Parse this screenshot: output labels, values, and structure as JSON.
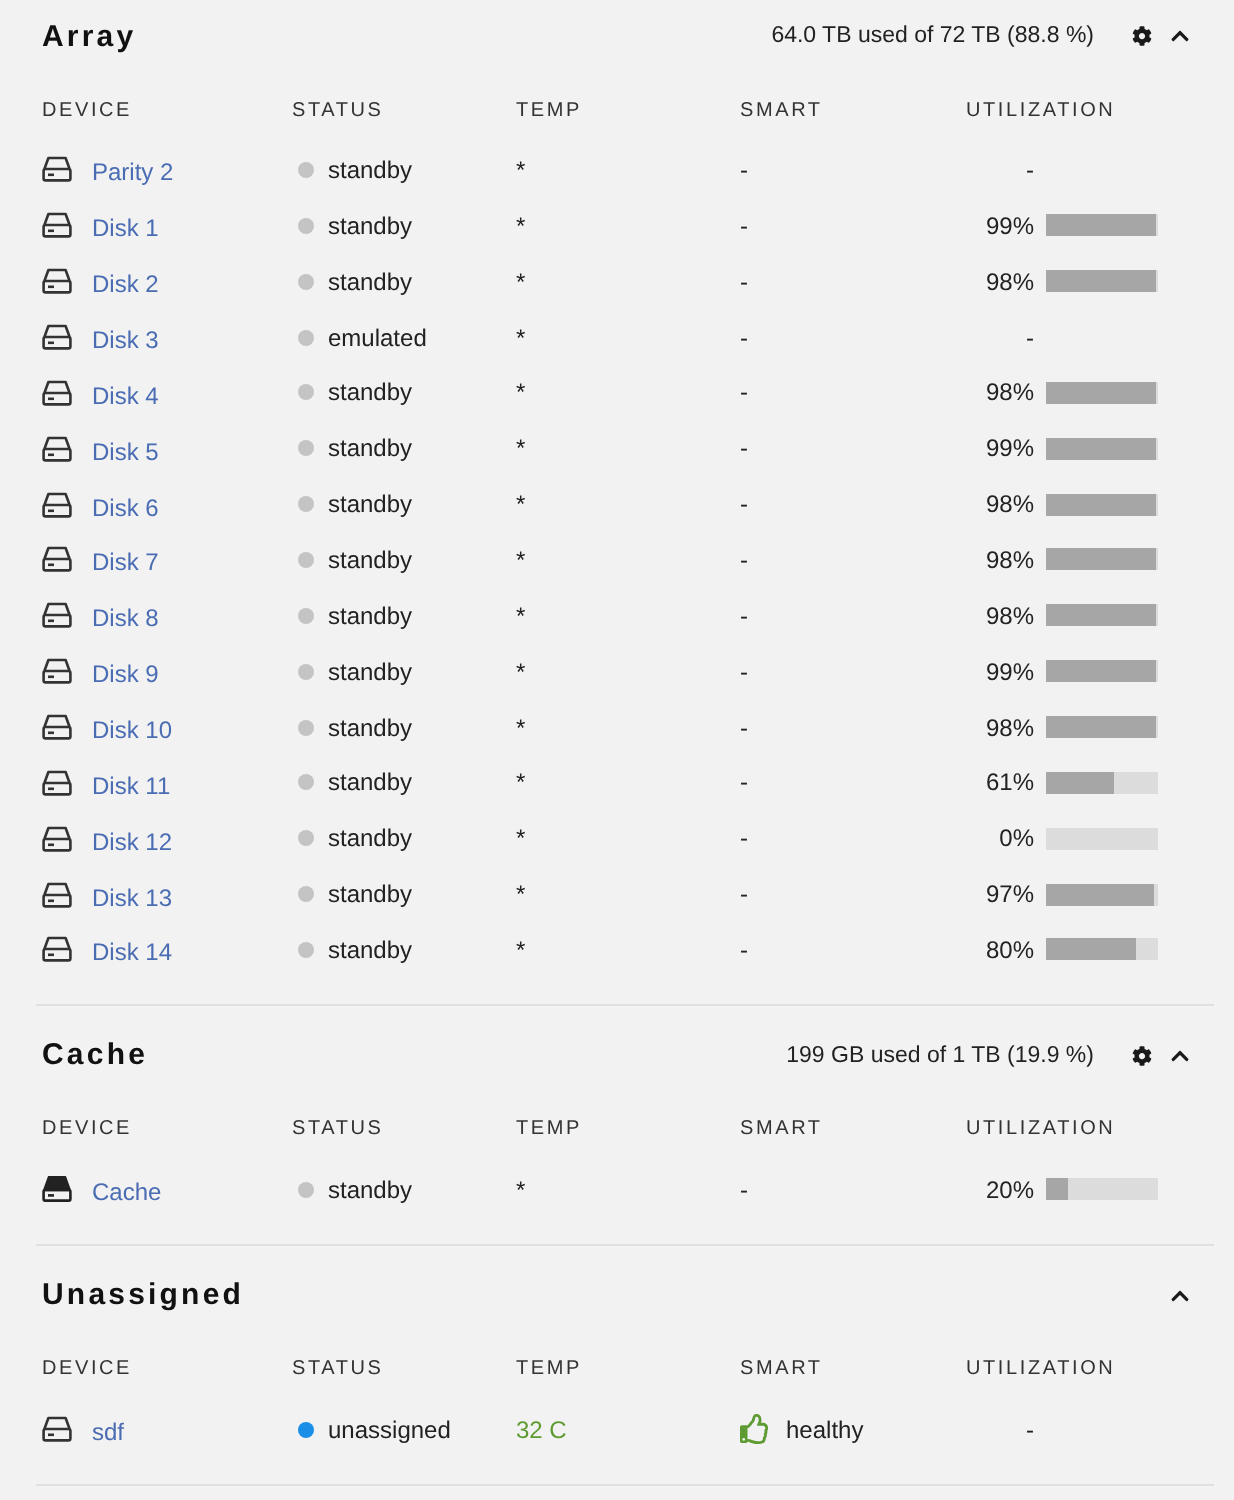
{
  "sections": [
    {
      "title": "Array",
      "summary": "64.0 TB used of 72 TB (88.8 %)",
      "settings": true,
      "expanded": true,
      "columns": [
        "DEVICE",
        "STATUS",
        "TEMP",
        "SMART",
        "UTILIZATION"
      ],
      "rows": [
        {
          "kind": "hdd",
          "name": "Parity 2",
          "status": {
            "text": "standby",
            "color": "#c4c4c4"
          },
          "temp": {
            "text": "*"
          },
          "smart": {
            "text": "-"
          },
          "utilization": {
            "text": "-"
          }
        },
        {
          "kind": "hdd",
          "name": "Disk 1",
          "status": {
            "text": "standby",
            "color": "#c4c4c4"
          },
          "temp": {
            "text": "*"
          },
          "smart": {
            "text": "-"
          },
          "utilization": {
            "text": "99%",
            "level": 0.99
          }
        },
        {
          "kind": "hdd",
          "name": "Disk 2",
          "status": {
            "text": "standby",
            "color": "#c4c4c4"
          },
          "temp": {
            "text": "*"
          },
          "smart": {
            "text": "-"
          },
          "utilization": {
            "text": "98%",
            "level": 0.98
          }
        },
        {
          "kind": "hdd",
          "name": "Disk 3",
          "status": {
            "text": "emulated",
            "color": "#c4c4c4"
          },
          "temp": {
            "text": "*"
          },
          "smart": {
            "text": "-"
          },
          "utilization": {
            "text": "-"
          }
        },
        {
          "kind": "hdd",
          "name": "Disk 4",
          "status": {
            "text": "standby",
            "color": "#c4c4c4"
          },
          "temp": {
            "text": "*"
          },
          "smart": {
            "text": "-"
          },
          "utilization": {
            "text": "98%",
            "level": 0.98
          }
        },
        {
          "kind": "hdd",
          "name": "Disk 5",
          "status": {
            "text": "standby",
            "color": "#c4c4c4"
          },
          "temp": {
            "text": "*"
          },
          "smart": {
            "text": "-"
          },
          "utilization": {
            "text": "99%",
            "level": 0.99
          }
        },
        {
          "kind": "hdd",
          "name": "Disk 6",
          "status": {
            "text": "standby",
            "color": "#c4c4c4"
          },
          "temp": {
            "text": "*"
          },
          "smart": {
            "text": "-"
          },
          "utilization": {
            "text": "98%",
            "level": 0.98
          }
        },
        {
          "kind": "hdd",
          "name": "Disk 7",
          "status": {
            "text": "standby",
            "color": "#c4c4c4"
          },
          "temp": {
            "text": "*"
          },
          "smart": {
            "text": "-"
          },
          "utilization": {
            "text": "98%",
            "level": 0.98
          }
        },
        {
          "kind": "hdd",
          "name": "Disk 8",
          "status": {
            "text": "standby",
            "color": "#c4c4c4"
          },
          "temp": {
            "text": "*"
          },
          "smart": {
            "text": "-"
          },
          "utilization": {
            "text": "98%",
            "level": 0.98
          }
        },
        {
          "kind": "hdd",
          "name": "Disk 9",
          "status": {
            "text": "standby",
            "color": "#c4c4c4"
          },
          "temp": {
            "text": "*"
          },
          "smart": {
            "text": "-"
          },
          "utilization": {
            "text": "99%",
            "level": 0.99
          }
        },
        {
          "kind": "hdd",
          "name": "Disk 10",
          "status": {
            "text": "standby",
            "color": "#c4c4c4"
          },
          "temp": {
            "text": "*"
          },
          "smart": {
            "text": "-"
          },
          "utilization": {
            "text": "98%",
            "level": 0.98
          }
        },
        {
          "kind": "hdd",
          "name": "Disk 11",
          "status": {
            "text": "standby",
            "color": "#c4c4c4"
          },
          "temp": {
            "text": "*"
          },
          "smart": {
            "text": "-"
          },
          "utilization": {
            "text": "61%",
            "level": 0.61
          }
        },
        {
          "kind": "hdd",
          "name": "Disk 12",
          "status": {
            "text": "standby",
            "color": "#c4c4c4"
          },
          "temp": {
            "text": "*"
          },
          "smart": {
            "text": "-"
          },
          "utilization": {
            "text": "0%",
            "level": 0
          }
        },
        {
          "kind": "hdd",
          "name": "Disk 13",
          "status": {
            "text": "standby",
            "color": "#c4c4c4"
          },
          "temp": {
            "text": "*"
          },
          "smart": {
            "text": "-"
          },
          "utilization": {
            "text": "97%",
            "level": 0.97
          }
        },
        {
          "kind": "hdd",
          "name": "Disk 14",
          "status": {
            "text": "standby",
            "color": "#c4c4c4"
          },
          "temp": {
            "text": "*"
          },
          "smart": {
            "text": "-"
          },
          "utilization": {
            "text": "80%",
            "level": 0.8
          }
        }
      ]
    },
    {
      "title": "Cache",
      "summary": "199 GB used of 1 TB (19.9 %)",
      "settings": true,
      "expanded": true,
      "columns": [
        "DEVICE",
        "STATUS",
        "TEMP",
        "SMART",
        "UTILIZATION"
      ],
      "rows": [
        {
          "kind": "cache",
          "name": "Cache",
          "status": {
            "text": "standby",
            "color": "#c4c4c4"
          },
          "temp": {
            "text": "*"
          },
          "smart": {
            "text": "-"
          },
          "utilization": {
            "text": "20%",
            "level": 0.2
          }
        }
      ]
    },
    {
      "title": "Unassigned",
      "expanded": true,
      "columns": [
        "DEVICE",
        "STATUS",
        "TEMP",
        "SMART",
        "UTILIZATION"
      ],
      "rows": [
        {
          "kind": "hdd",
          "name": "sdf",
          "status": {
            "text": "unassigned",
            "color": "#1a8fe8"
          },
          "temp": {
            "text": "32 C",
            "color": "#5e9b32"
          },
          "smart": {
            "text": "healthy",
            "healthy": true
          },
          "utilization": {
            "text": "-"
          }
        }
      ]
    }
  ]
}
